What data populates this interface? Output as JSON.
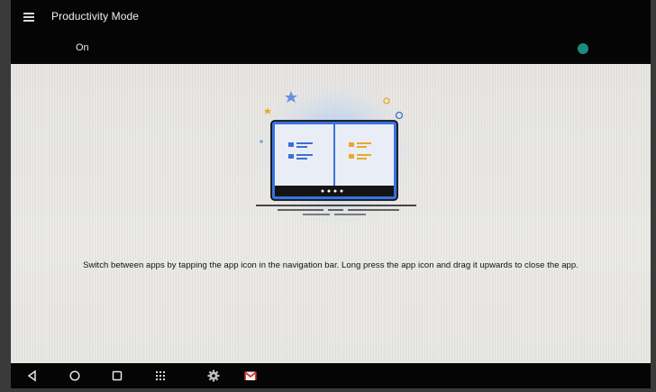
{
  "header": {
    "title": "Productivity Mode",
    "toggle_label": "On",
    "toggle_color": "#1a8c7e"
  },
  "main": {
    "description": "Switch between apps by tapping the app icon in the navigation bar. Long press the app icon and drag it upwards to close the app.",
    "illustration": {
      "name": "split-screen-laptop",
      "left_pane_color": "#3c6fd6",
      "right_pane_color": "#e9a92a",
      "frame_color": "#2b66d9",
      "glow_color": "#9cc0f2"
    }
  },
  "navbar": {
    "icons": [
      "back-icon",
      "home-icon",
      "recents-icon",
      "app-grid-icon",
      "settings-gear-icon",
      "gmail-icon"
    ]
  }
}
